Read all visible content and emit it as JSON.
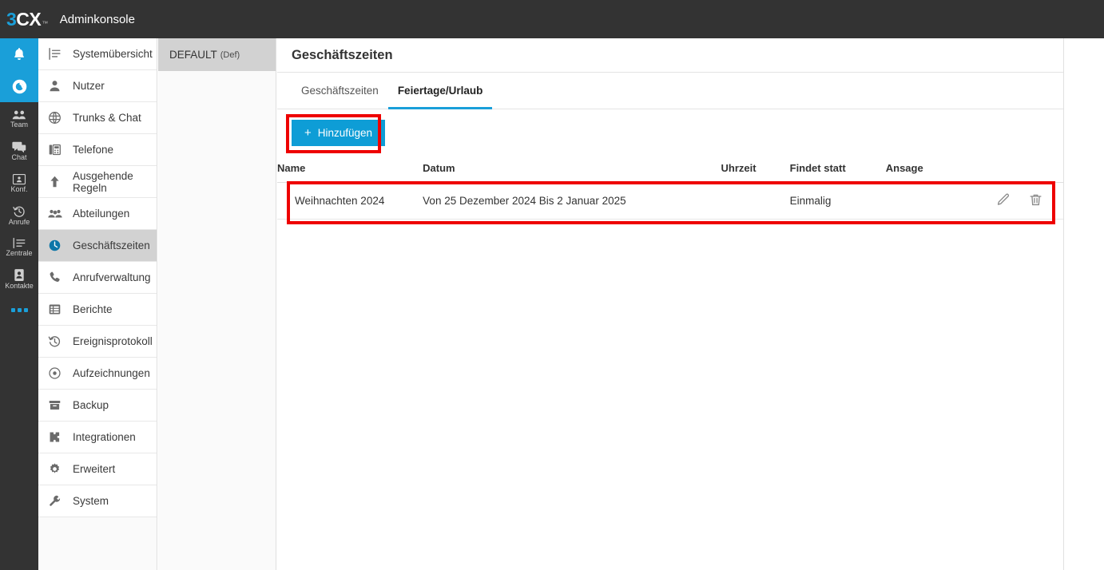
{
  "topbar": {
    "logo_3": "3",
    "logo_cx": "CX",
    "logo_tm": "™",
    "title": "Adminkonsole"
  },
  "rail": {
    "items": [
      {
        "icon": "bell-icon",
        "label": "",
        "active": true
      },
      {
        "icon": "web-client-icon",
        "label": "",
        "active": true
      },
      {
        "icon": "team-icon",
        "label": "Team",
        "active": false
      },
      {
        "icon": "chat-icon",
        "label": "Chat",
        "active": false
      },
      {
        "icon": "conference-icon",
        "label": "Konf.",
        "active": false
      },
      {
        "icon": "calls-history-icon",
        "label": "Anrufe",
        "active": false
      },
      {
        "icon": "switchboard-icon",
        "label": "Zentrale",
        "active": false
      },
      {
        "icon": "contacts-icon",
        "label": "Kontakte",
        "active": false
      },
      {
        "icon": "more-dots-icon",
        "label": "",
        "active": false
      }
    ]
  },
  "sidebar": {
    "items": [
      {
        "label": "Systemübersicht",
        "icon": "overview-icon",
        "selected": false
      },
      {
        "label": "Nutzer",
        "icon": "user-icon",
        "selected": false
      },
      {
        "label": "Trunks & Chat",
        "icon": "globe-icon",
        "selected": false
      },
      {
        "label": "Telefone",
        "icon": "phone-device-icon",
        "selected": false
      },
      {
        "label": "Ausgehende\nRegeln",
        "icon": "arrow-up-icon",
        "selected": false
      },
      {
        "label": "Abteilungen",
        "icon": "departments-icon",
        "selected": false
      },
      {
        "label": "Geschäftszeiten",
        "icon": "clock-icon",
        "selected": true
      },
      {
        "label": "Anrufverwaltung",
        "icon": "handset-icon",
        "selected": false
      },
      {
        "label": "Berichte",
        "icon": "reports-icon",
        "selected": false
      },
      {
        "label": "Ereignisprotokoll",
        "icon": "history-icon",
        "selected": false
      },
      {
        "label": "Aufzeichnungen",
        "icon": "record-icon",
        "selected": false
      },
      {
        "label": "Backup",
        "icon": "archive-icon",
        "selected": false
      },
      {
        "label": "Integrationen",
        "icon": "puzzle-icon",
        "selected": false
      },
      {
        "label": "Erweitert",
        "icon": "gear-icon",
        "selected": false
      },
      {
        "label": "System",
        "icon": "wrench-icon",
        "selected": false
      }
    ]
  },
  "groups": {
    "items": [
      {
        "label": "DEFAULT",
        "sub": "(Def)",
        "selected": true
      }
    ]
  },
  "main": {
    "page_title": "Geschäftszeiten",
    "tabs": [
      {
        "label": "Geschäftszeiten",
        "active": false
      },
      {
        "label": "Feiertage/Urlaub",
        "active": true
      }
    ],
    "toolbar": {
      "add_plus": "+",
      "add_label": "Hinzufügen"
    },
    "table": {
      "columns": [
        "Name",
        "Datum",
        "Uhrzeit",
        "Findet statt",
        "Ansage"
      ],
      "rows": [
        {
          "name": "Weihnachten 2024",
          "date": "Von 25 Dezember 2024 Bis 2 Januar 2025",
          "time": "",
          "occurrence": "Einmalig",
          "announcement": "",
          "actions": [
            "edit-icon",
            "delete-icon"
          ]
        }
      ]
    }
  },
  "colors": {
    "brand_blue": "#1a9fd9",
    "button_blue": "#0e9dd6",
    "topbar_dark": "#333333",
    "annotation_red": "#ee0000",
    "selected_gray": "#d2d2d2"
  }
}
